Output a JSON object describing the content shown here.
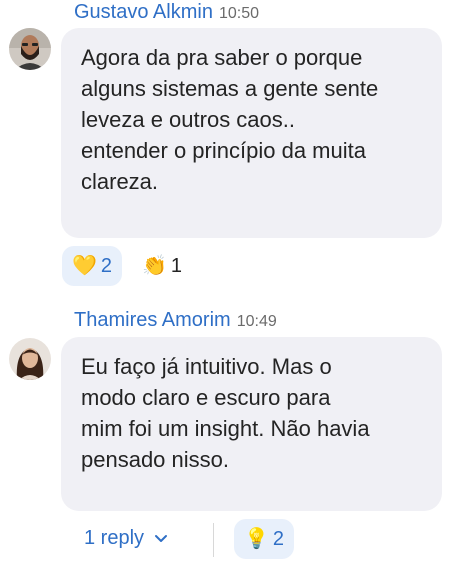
{
  "messages": [
    {
      "author": "Gustavo Alkmin",
      "time": "10:50",
      "text": "Agora da pra saber o porque\nalguns sistemas a gente sente\nleveza e outros caos..\nentender o princípio da muita\nclareza.",
      "reactions": [
        {
          "emoji": "💛",
          "count": "2",
          "mine": true
        },
        {
          "emoji": "👏",
          "count": "1",
          "mine": false
        }
      ]
    },
    {
      "author": "Thamires Amorim",
      "time": "10:49",
      "text": "Eu faço já intuitivo. Mas o\nmodo claro e escuro para\nmim foi um insight. Não havia\npensado nisso.",
      "reply_label": "1 reply",
      "reactions": [
        {
          "emoji": "💡",
          "count": "2",
          "mine": true
        }
      ]
    }
  ],
  "colors": {
    "accent": "#2f6fc6",
    "bubble": "#f0f0f5",
    "reaction_mine_bg": "#e8f0fb"
  },
  "icons": {
    "reply_expand": "chevron-down-icon"
  }
}
